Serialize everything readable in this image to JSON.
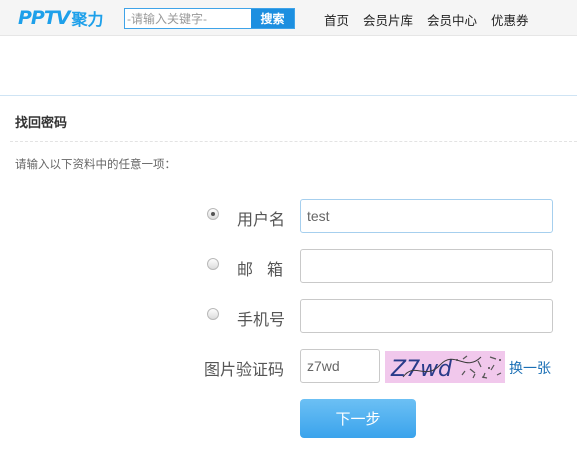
{
  "header": {
    "logo_mark": "PPTV",
    "logo_text": "聚力",
    "search": {
      "placeholder": "-请输入关键字-",
      "button_label": "搜索"
    },
    "nav": [
      "首页",
      "会员片库",
      "会员中心",
      "优惠券"
    ]
  },
  "page": {
    "title": "找回密码",
    "instruction": "请输入以下资料中的任意一项："
  },
  "form": {
    "options": [
      {
        "label": "用户名",
        "value": "test",
        "selected": true
      },
      {
        "label": "邮箱",
        "value": "",
        "selected": false
      },
      {
        "label": "手机号",
        "value": "",
        "selected": false
      }
    ],
    "captcha": {
      "label": "图片验证码",
      "value": "z7wd",
      "image_text": "Z7wd",
      "refresh_label": "换一张"
    },
    "submit_label": "下一步"
  },
  "colors": {
    "brand_blue": "#1ea0ea",
    "search_button": "#1c8fe0",
    "link": "#1a6fb5",
    "captcha_bg": "#f1c8ec",
    "submit_button": "#4aaaee"
  }
}
